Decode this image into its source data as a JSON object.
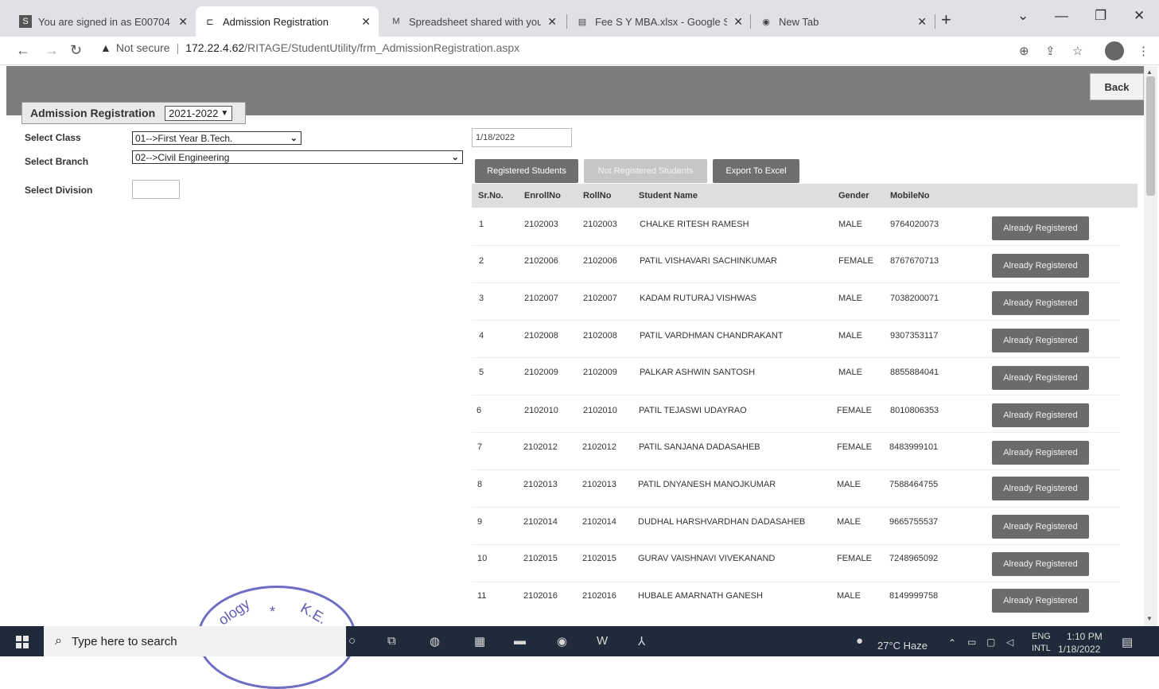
{
  "browser": {
    "tabs": [
      {
        "title": "You are signed in as E00704",
        "icon": "s-icon",
        "active": false
      },
      {
        "title": "Admission Registration",
        "icon": "site-icon",
        "active": true
      },
      {
        "title": "Spreadsheet shared with you",
        "icon": "mail-icon",
        "active": false
      },
      {
        "title": "Fee S Y MBA.xlsx - Google S",
        "icon": "sheets-icon",
        "active": false
      },
      {
        "title": "New Tab",
        "icon": "chrome-icon",
        "active": false
      }
    ],
    "address": {
      "security": "Not secure",
      "host": "172.22.4.62",
      "path": "/RITAGE/StudentUtility/frm_AdmissionRegistration.aspx"
    }
  },
  "page": {
    "back_label": "Back",
    "form_title": "Admission Registration",
    "academic_year": "2021-2022",
    "select_class_label": "Select Class",
    "select_class_value": "01-->First Year B.Tech.",
    "select_branch_label": "Select Branch",
    "select_branch_value": "02-->Civil Engineering",
    "select_division_label": "Select Division",
    "date_value": "1/18/2022",
    "buttons": {
      "registered": "Registered Students",
      "not_registered": "Not Registered Students",
      "export": "Export To Excel"
    },
    "table": {
      "headers": [
        "Sr.No.",
        "EnrollNo",
        "RollNo",
        "Student Name",
        "Gender",
        "MobileNo"
      ],
      "action_label": "Already Registered",
      "rows": [
        {
          "sr": "1",
          "enroll": "2102003",
          "roll": "2102003",
          "name": "CHALKE RITESH RAMESH",
          "gender": "MALE",
          "mobile": "9764020073"
        },
        {
          "sr": "2",
          "enroll": "2102006",
          "roll": "2102006",
          "name": "PATIL VISHAVARI SACHINKUMAR",
          "gender": "FEMALE",
          "mobile": "8767670713"
        },
        {
          "sr": "3",
          "enroll": "2102007",
          "roll": "2102007",
          "name": "KADAM RUTURAJ VISHWAS",
          "gender": "MALE",
          "mobile": "7038200071"
        },
        {
          "sr": "4",
          "enroll": "2102008",
          "roll": "2102008",
          "name": "PATIL VARDHMAN CHANDRAKANT",
          "gender": "MALE",
          "mobile": "9307353117"
        },
        {
          "sr": "5",
          "enroll": "2102009",
          "roll": "2102009",
          "name": "PALKAR ASHWIN SANTOSH",
          "gender": "MALE",
          "mobile": "8855884041"
        },
        {
          "sr": "6",
          "enroll": "2102010",
          "roll": "2102010",
          "name": "PATIL TEJASWI UDAYRAO",
          "gender": "FEMALE",
          "mobile": "8010806353"
        },
        {
          "sr": "7",
          "enroll": "2102012",
          "roll": "2102012",
          "name": "PATIL SANJANA DADASAHEB",
          "gender": "FEMALE",
          "mobile": "8483999101"
        },
        {
          "sr": "8",
          "enroll": "2102013",
          "roll": "2102013",
          "name": "PATIL DNYANESH MANOJKUMAR",
          "gender": "MALE",
          "mobile": "7588464755"
        },
        {
          "sr": "9",
          "enroll": "2102014",
          "roll": "2102014",
          "name": "DUDHAL HARSHVARDHAN DADASAHEB",
          "gender": "MALE",
          "mobile": "9665755537"
        },
        {
          "sr": "10",
          "enroll": "2102015",
          "roll": "2102015",
          "name": "GURAV VAISHNAVI VIVEKANAND",
          "gender": "FEMALE",
          "mobile": "7248965092"
        },
        {
          "sr": "11",
          "enroll": "2102016",
          "roll": "2102016",
          "name": "HUBALE AMARNATH GANESH",
          "gender": "MALE",
          "mobile": "8149999758"
        }
      ]
    }
  },
  "stamp": {
    "text": "ology * K.E. S.W Dist.Sangli"
  },
  "taskbar": {
    "search_placeholder": "Type here to search",
    "weather": "27°C Haze",
    "lang_top": "ENG",
    "lang_bottom": "INTL",
    "time": "1:10 PM",
    "date": "1/18/2022"
  }
}
